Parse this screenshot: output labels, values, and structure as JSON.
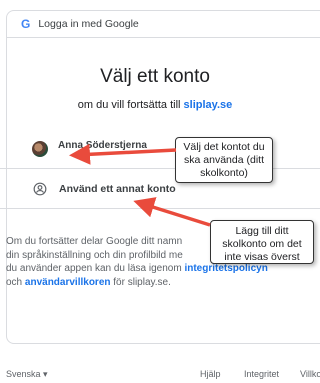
{
  "header": {
    "logo_letter": "G",
    "title": "Logga in med Google"
  },
  "main": {
    "title": "Välj ett konto",
    "subtitle_prefix": "om du vill fortsätta till ",
    "subtitle_link": "sliplay.se",
    "account_name": "Anna Söderstjerna",
    "other_account_label": "Använd ett annat konto",
    "info_part1": "Om du fortsätter delar Google ditt namn",
    "info_part2": "din språkinställning och din profilbild me",
    "info_part3": "du använder appen kan du läsa igenom ",
    "info_link1": "integritetspolicyn",
    "info_part4": "och ",
    "info_link2": "användarvillkoren",
    "info_part5": " för sliplay.se."
  },
  "callouts": {
    "c1": "Välj det kontot du ska använda (ditt skolkonto)",
    "c2": "Lägg till ditt skolkonto om det inte visas överst"
  },
  "footer": {
    "language": "Svenska ▾",
    "links": [
      "Hjälp",
      "Integritet",
      "Villko"
    ]
  },
  "colors": {
    "arrow": "#e94b3c",
    "link": "#1a73e8"
  },
  "icons": {
    "logo": "google-g-icon",
    "other_account": "account-circle-icon"
  }
}
